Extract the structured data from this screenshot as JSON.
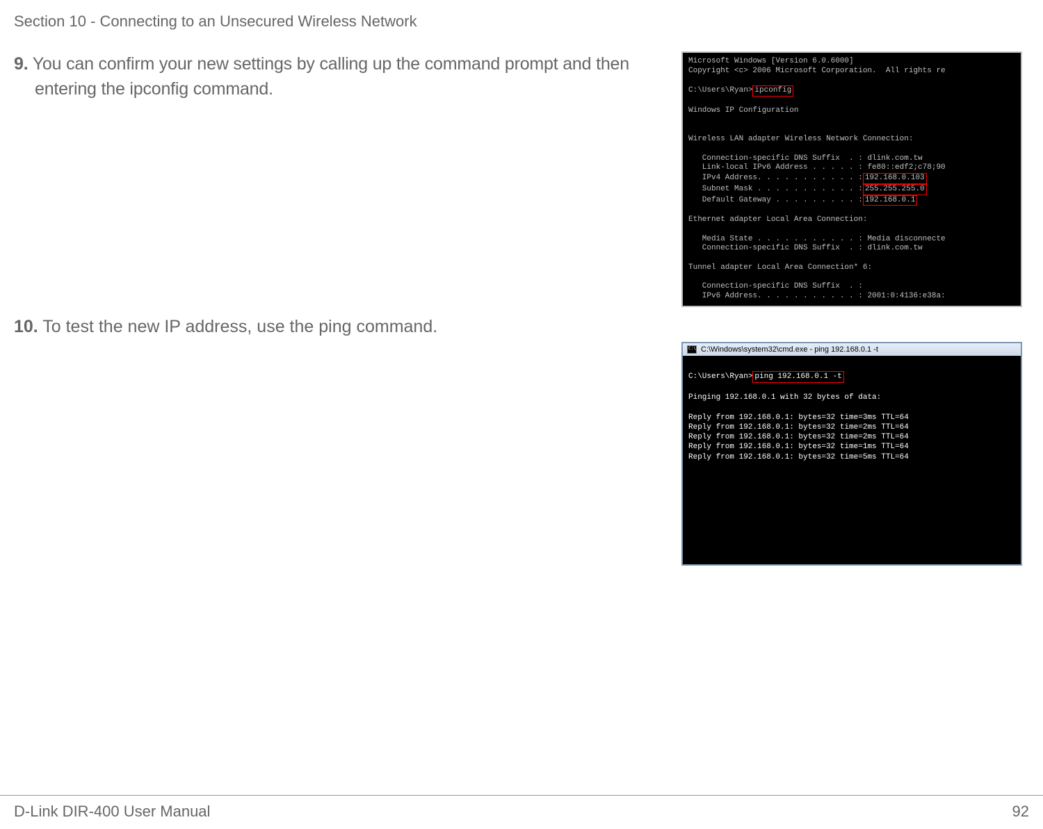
{
  "header": {
    "section_title": "Section 10 - Connecting to an Unsecured Wireless Network"
  },
  "steps": {
    "step9": {
      "num": "9.",
      "text": " You can confirm your new settings by calling up the command prompt and then entering the ipconfig command."
    },
    "step10": {
      "num": "10.",
      "text": " To test the new IP address, use the ping command."
    }
  },
  "cmd1": {
    "line1": "Microsoft Windows [Version 6.0.6000]",
    "line2": "Copyright <c> 2006 Microsoft Corporation.  All rights re",
    "prompt": "C:\\Users\\Ryan>",
    "cmd_boxed": "ipconfig",
    "sec_title": "Windows IP Configuration",
    "wlan_title": "Wireless LAN adapter Wireless Network Connection:",
    "wlan_l1": "   Connection-specific DNS Suffix  . : dlink.com.tw",
    "wlan_l2": "   Link-local IPv6 Address . . . . . : fe80::edf2;c78;90",
    "wlan_l3a": "   IPv4 Address. . . . . . . . . . . :",
    "wlan_l3b": "192.168.0.103",
    "wlan_l4a": "   Subnet Mask . . . . . . . . . . . :",
    "wlan_l4b": "255.255.255.0",
    "wlan_l5a": "   Default Gateway . . . . . . . . . :",
    "wlan_l5b": "192.168.0.1",
    "eth_title": "Ethernet adapter Local Area Connection:",
    "eth_l1": "   Media State . . . . . . . . . . . : Media disconnecte",
    "eth_l2": "   Connection-specific DNS Suffix  . : dlink.com.tw",
    "tun_title": "Tunnel adapter Local Area Connection* 6:",
    "tun_l1": "   Connection-specific DNS Suffix  . :",
    "tun_l2": "   IPv6 Address. . . . . . . . . . . : 2001:0:4136:e38a:"
  },
  "cmd2": {
    "title": "C:\\Windows\\system32\\cmd.exe - ping  192.168.0.1 -t",
    "prompt": "C:\\Users\\Ryan>",
    "cmd_boxed": "ping 192.168.0.1 -t",
    "pinging": "Pinging 192.168.0.1 with 32 bytes of data:",
    "r1": "Reply from 192.168.0.1: bytes=32 time=3ms TTL=64",
    "r2": "Reply from 192.168.0.1: bytes=32 time=2ms TTL=64",
    "r3": "Reply from 192.168.0.1: bytes=32 time=2ms TTL=64",
    "r4": "Reply from 192.168.0.1: bytes=32 time=1ms TTL=64",
    "r5": "Reply from 192.168.0.1: bytes=32 time=5ms TTL=64"
  },
  "footer": {
    "left": "D-Link DIR-400 User Manual",
    "right": "92"
  }
}
